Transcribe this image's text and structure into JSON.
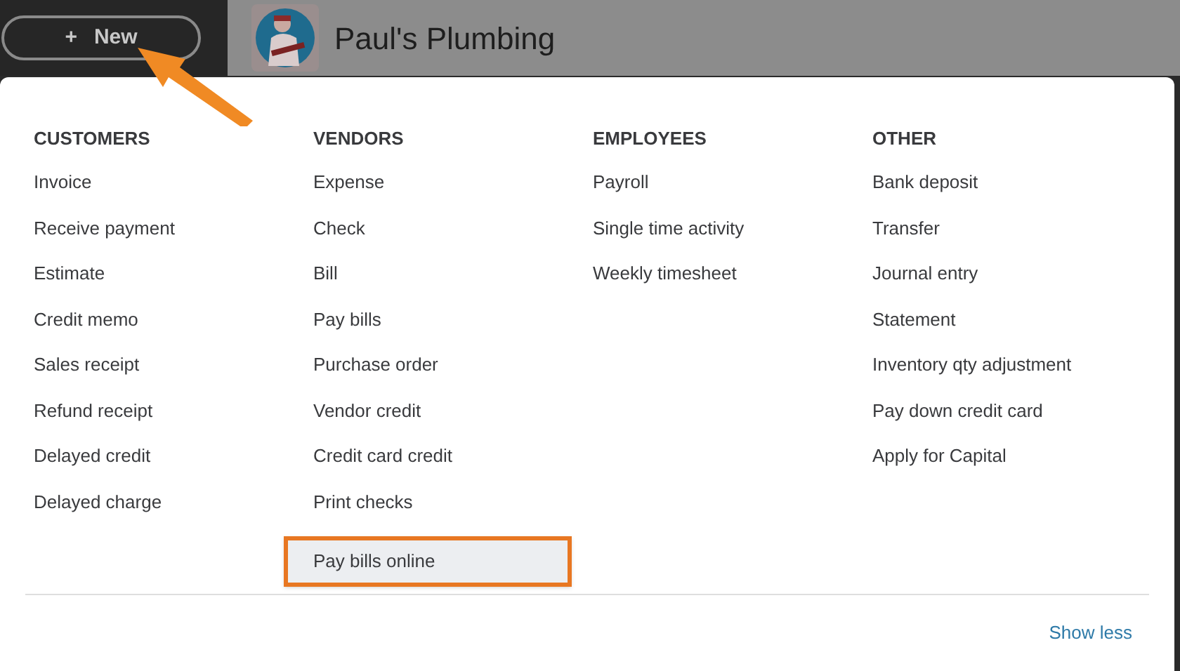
{
  "new_button": {
    "icon": "+",
    "label": "New"
  },
  "company": {
    "name": "Paul's Plumbing"
  },
  "columns": [
    {
      "heading": "CUSTOMERS",
      "items": [
        {
          "label": "Invoice",
          "highlighted": false
        },
        {
          "label": "Receive payment",
          "highlighted": false
        },
        {
          "label": "Estimate",
          "highlighted": false
        },
        {
          "label": "Credit memo",
          "highlighted": false
        },
        {
          "label": "Sales receipt",
          "highlighted": false
        },
        {
          "label": "Refund receipt",
          "highlighted": false
        },
        {
          "label": "Delayed credit",
          "highlighted": false
        },
        {
          "label": "Delayed charge",
          "highlighted": false
        }
      ]
    },
    {
      "heading": "VENDORS",
      "items": [
        {
          "label": "Expense",
          "highlighted": false
        },
        {
          "label": "Check",
          "highlighted": false
        },
        {
          "label": "Bill",
          "highlighted": false
        },
        {
          "label": "Pay bills",
          "highlighted": false
        },
        {
          "label": "Purchase order",
          "highlighted": false
        },
        {
          "label": "Vendor credit",
          "highlighted": false
        },
        {
          "label": "Credit card credit",
          "highlighted": false
        },
        {
          "label": "Print checks",
          "highlighted": false
        },
        {
          "label": "Pay bills online",
          "highlighted": true
        }
      ]
    },
    {
      "heading": "EMPLOYEES",
      "items": [
        {
          "label": "Payroll",
          "highlighted": false
        },
        {
          "label": "Single time activity",
          "highlighted": false
        },
        {
          "label": "Weekly timesheet",
          "highlighted": false
        }
      ]
    },
    {
      "heading": "OTHER",
      "items": [
        {
          "label": "Bank deposit",
          "highlighted": false
        },
        {
          "label": "Transfer",
          "highlighted": false
        },
        {
          "label": "Journal entry",
          "highlighted": false
        },
        {
          "label": "Statement",
          "highlighted": false
        },
        {
          "label": "Inventory qty adjustment",
          "highlighted": false
        },
        {
          "label": "Pay down credit card",
          "highlighted": false
        },
        {
          "label": "Apply for Capital",
          "highlighted": false
        }
      ]
    }
  ],
  "footer_link": "Show less"
}
